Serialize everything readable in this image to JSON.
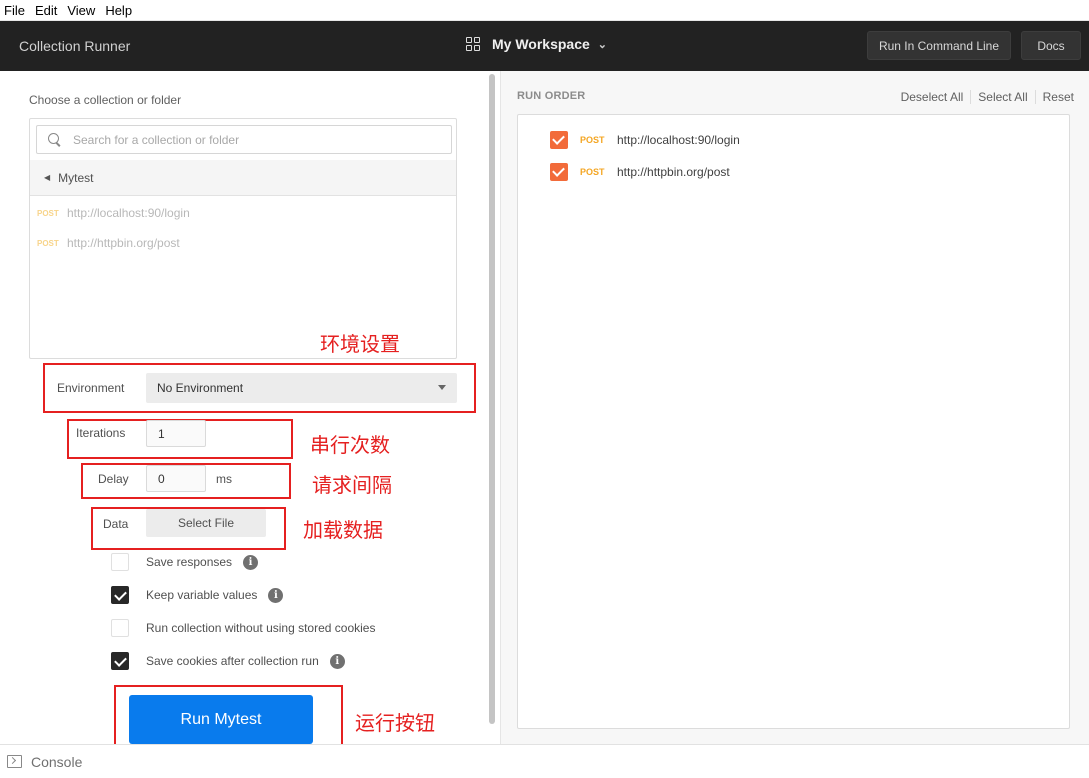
{
  "menu": [
    "File",
    "Edit",
    "View",
    "Help"
  ],
  "topbar": {
    "title": "Collection Runner",
    "workspace": "My Workspace",
    "run_cli": "Run In Command Line",
    "docs": "Docs"
  },
  "left": {
    "choose_label": "Choose a collection or folder",
    "search_placeholder": "Search for a collection or folder",
    "collection": "Mytest",
    "requests": [
      {
        "method": "POST",
        "url": "http://localhost:90/login"
      },
      {
        "method": "POST",
        "url": "http://httpbin.org/post"
      }
    ],
    "environment_label": "Environment",
    "environment_value": "No Environment",
    "iterations_label": "Iterations",
    "iterations_value": "1",
    "delay_label": "Delay",
    "delay_value": "0",
    "delay_unit": "ms",
    "data_label": "Data",
    "select_file": "Select File",
    "options": [
      {
        "label": "Save responses",
        "checked": false,
        "info": true
      },
      {
        "label": "Keep variable values",
        "checked": true,
        "info": true
      },
      {
        "label": "Run collection without using stored cookies",
        "checked": false,
        "info": false
      },
      {
        "label": "Save cookies after collection run",
        "checked": true,
        "info": true
      }
    ],
    "run_button": "Run Mytest"
  },
  "annotations": {
    "env": "环境设置",
    "iterations": "串行次数",
    "delay": "请求间隔",
    "data": "加载数据",
    "run": "运行按钮"
  },
  "right": {
    "title": "RUN ORDER",
    "deselect_all": "Deselect All",
    "select_all": "Select All",
    "reset": "Reset",
    "items": [
      {
        "method": "POST",
        "url": "http://localhost:90/login",
        "checked": true
      },
      {
        "method": "POST",
        "url": "http://httpbin.org/post",
        "checked": true
      }
    ]
  },
  "console": "Console",
  "colors": {
    "accent": "#097bed",
    "annotation": "#e52020",
    "checkbox_orange": "#f26b3a",
    "method_post": "#f4a623"
  }
}
